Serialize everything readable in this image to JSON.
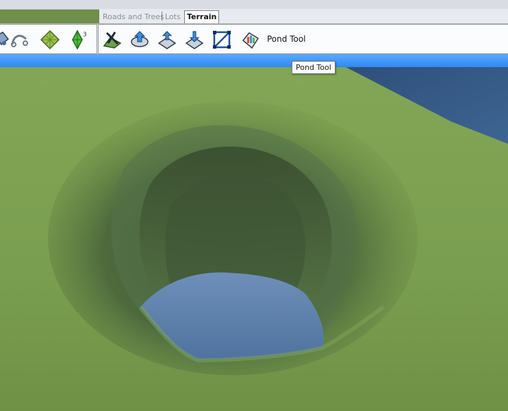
{
  "tabs": [
    {
      "label": "Roads and Trees"
    },
    {
      "label": "Lots"
    },
    {
      "label": "Terrain"
    }
  ],
  "active_tab": "Terrain",
  "toolbar": {
    "left_icons": [
      "paint-bucket-icon",
      "road-curve-icon",
      "terrain-grid-icon",
      "plumbob-3-icon"
    ],
    "terrain_tools": [
      "terrain-paint-brush-icon",
      "raise-terrain-icon",
      "smooth-terrain-icon",
      "lower-terrain-icon",
      "flatten-terrain-icon",
      "pond-tool-icon"
    ],
    "pond_label": "Pond Tool"
  },
  "tooltip": {
    "text": "Pond Tool"
  },
  "colors": {
    "grass": "#7aa04f",
    "water": "#5b7fa8",
    "accent_bar": "#3f95f6"
  }
}
